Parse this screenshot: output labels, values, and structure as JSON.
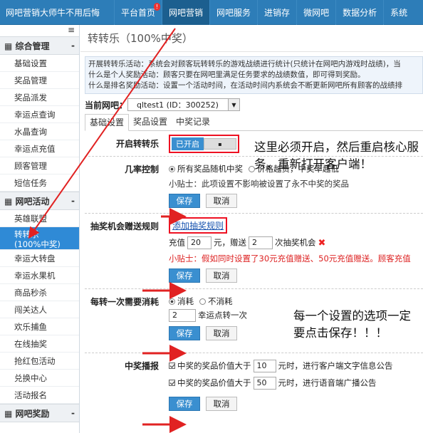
{
  "topbar": {
    "brand": "网吧营销大师牛不用后悔",
    "nav": [
      "平台首页",
      "网吧营销",
      "网吧服务",
      "进销存",
      "微网吧",
      "数据分析",
      "系统"
    ],
    "badge": "!"
  },
  "sidebar": {
    "collapse_icon": "≡",
    "groups": [
      {
        "title": "综合管理",
        "toggle": "-",
        "items": [
          "基础设置",
          "奖品管理",
          "奖品派发",
          "幸运点查询",
          "水晶查询",
          "幸运点充值",
          "顾客管理",
          "短信任务"
        ]
      },
      {
        "title": "网吧活动",
        "toggle": "-",
        "items": [
          "英雄联盟",
          "转转乐\n(100%中奖)",
          "幸运大转盘",
          "幸运水果机",
          "商品秒杀",
          "闯关达人",
          "欢乐捕鱼",
          "在线抽奖",
          "抢红包活动",
          "兑换中心",
          "活动报名"
        ]
      },
      {
        "title": "网吧奖励",
        "toggle": "-"
      }
    ]
  },
  "main": {
    "title": "转转乐（100%中奖）",
    "desc": [
      "开展转转乐活动：系统会对顾客玩转转乐的游戏战绩进行统计(只统计在网吧内游戏时战绩)，当",
      "什么是个人奖励活动：顾客只要在网吧里满足任务要求的战绩数值，即可得到奖励。",
      "什么是排名奖励活动：设置一个活动时间，在活动时间内系统会不断更新网吧所有顾客的战绩排"
    ],
    "net_label": "当前网吧：",
    "net_value": "qltest1 (ID：300252)",
    "tabs": [
      "基础设置",
      "奖品设置",
      "中奖记录"
    ],
    "row1": {
      "label": "开启转转乐",
      "toggle": "已开启"
    },
    "row2": {
      "label": "几率控制",
      "opt1": "所有奖品随机中奖",
      "opt2": "价格越贵，中奖率越低",
      "tip": "小贴士：此项设置不影响被设置了永不中奖的奖品"
    },
    "row3": {
      "label": "抽奖机会赠送规则",
      "add_link": "添加抽奖规则",
      "t1": "充值",
      "v1": "20",
      "t2": "元，赠送",
      "v2": "2",
      "t3": "次抽奖机会",
      "tip": "小贴士：假如同时设置了30元充值赠送、50元充值赠送。顾客充值"
    },
    "row4": {
      "label": "每转一次需要消耗",
      "opt1": "消耗",
      "opt2": "不消耗",
      "v1": "2",
      "t1": "幸运点转一次"
    },
    "row5": {
      "label": "中奖播报",
      "c1a": "中奖的奖品价值大于",
      "c1v": "10",
      "c1b": "元时，进行客户端文字信息公告",
      "c2a": "中奖的奖品价值大于",
      "c2v": "50",
      "c2b": "元时，进行语音端广播公告"
    },
    "save": "保存",
    "cancel": "取消"
  },
  "annotations": {
    "a1": "这里必须开启，然后重启核心服务，重新打开客户端！",
    "a2": "每一个设置的选项一定要点击保存！！！"
  },
  "colors": {
    "topbar": "#2d7db8",
    "accent": "#3a8fd0",
    "highlight": "#e12222"
  }
}
